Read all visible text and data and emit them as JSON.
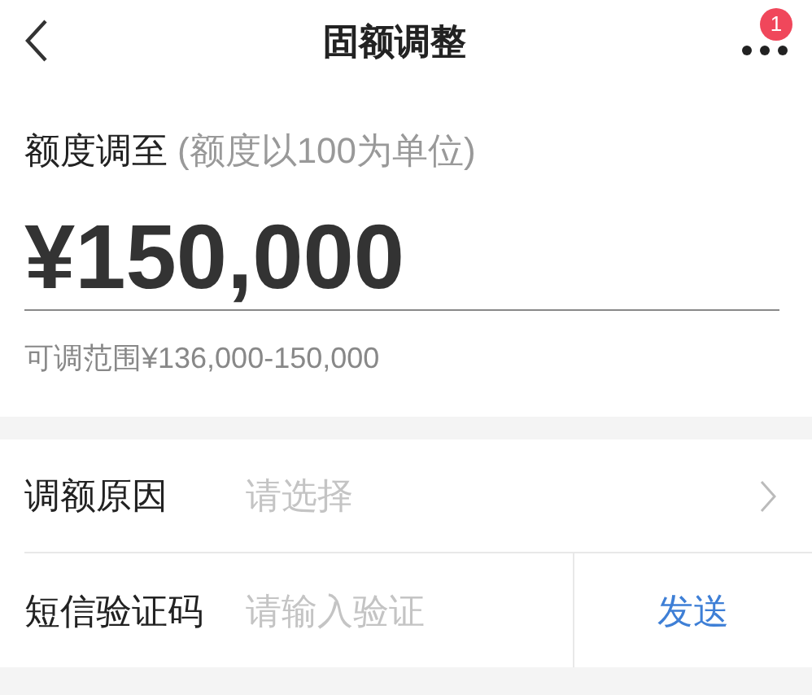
{
  "header": {
    "title": "固额调整",
    "badge": "1"
  },
  "amount": {
    "label": "额度调至",
    "hint": "(额度以100为单位)",
    "value": "¥150,000",
    "range": "可调范围¥136,000-150,000"
  },
  "form": [
    {
      "kind": "select",
      "label": "调额原因",
      "placeholder": "请选择"
    },
    {
      "kind": "code",
      "label": "短信验证码",
      "placeholder": "请输入验证",
      "button": "发送"
    }
  ]
}
